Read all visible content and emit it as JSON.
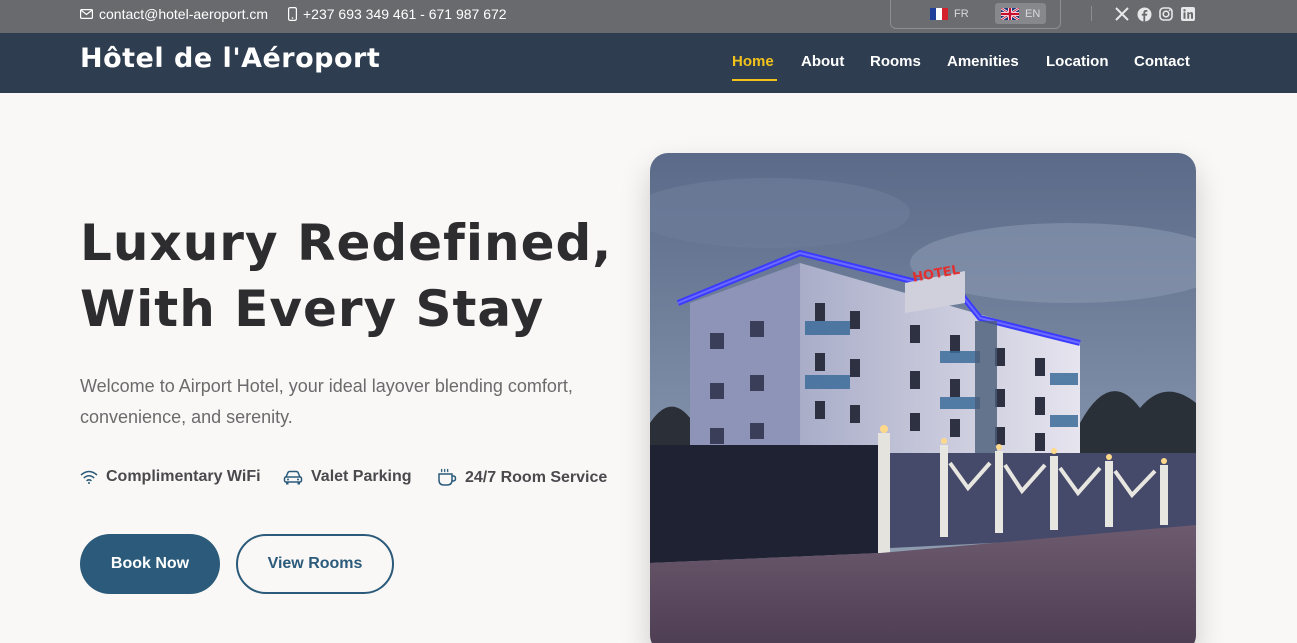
{
  "topbar": {
    "email": "contact@hotel-aeroport.cm",
    "phone": "+237 693 349 461 - 671 987 672",
    "languages": [
      {
        "code": "FR",
        "active": false
      },
      {
        "code": "EN",
        "active": true
      }
    ],
    "social": [
      "x-icon",
      "facebook-icon",
      "instagram-icon",
      "linkedin-icon"
    ]
  },
  "nav": {
    "brand": "Hôtel de l'Aéroport",
    "links": [
      "Home",
      "About",
      "Rooms",
      "Amenities",
      "Location",
      "Contact"
    ],
    "active": "Home"
  },
  "hero": {
    "title_line1": "Luxury Redefined,",
    "title_line2": "With Every Stay",
    "subtitle_line1": "Welcome to Airport Hotel, your ideal layover blending comfort,",
    "subtitle_line2": "convenience, and serenity.",
    "features": [
      {
        "icon": "wifi-icon",
        "label": "Complimentary WiFi"
      },
      {
        "icon": "car-icon",
        "label": "Valet Parking"
      },
      {
        "icon": "coffee-cup-icon",
        "label": "24/7 Room Service"
      }
    ],
    "primary_button": "Book Now",
    "secondary_button": "View Rooms",
    "image_sign_text": "HOTEL"
  },
  "colors": {
    "topbar_bg": "#696a6e",
    "nav_bg": "#2e3d4f",
    "accent": "#f2c21b",
    "primary": "#2b5a7a",
    "page_bg": "#f9f8f6"
  }
}
